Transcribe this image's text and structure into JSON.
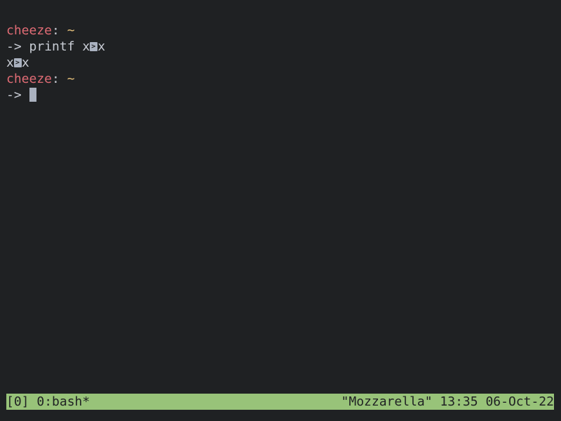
{
  "prompt": {
    "user": "cheeze",
    "separator": ": ",
    "path": "~",
    "arrow": "->"
  },
  "history": {
    "command_name": "printf",
    "command_arg_before": "x",
    "command_arg_after": "x",
    "output_before": "x",
    "output_after": "x",
    "unprintable_icon": "escape-char-icon"
  },
  "statusbar": {
    "session": "[0]",
    "window": "0:bash*",
    "host": "\"Mozzarella\"",
    "time": "13:35",
    "date": "06-Oct-22"
  },
  "colors": {
    "background": "#1f2123",
    "user": "#e06c75",
    "path": "#e5c07b",
    "statusbar": "#98c379"
  }
}
